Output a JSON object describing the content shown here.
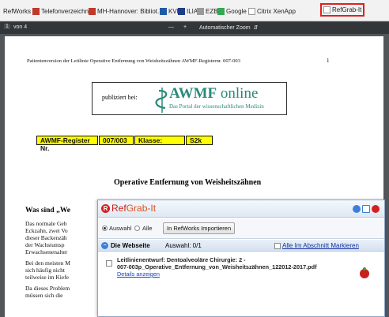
{
  "bookmarks": [
    {
      "label": "RefWorks",
      "icon": "none",
      "color": ""
    },
    {
      "label": "Telefonverzeichnis",
      "icon": "flag-icon",
      "color": "#c0392b"
    },
    {
      "label": "MH-Hannover: Bibliot...",
      "icon": "mhh-icon",
      "color": "#c0392b"
    },
    {
      "label": "KVK",
      "icon": "kvk-icon",
      "color": "#1f5aa6"
    },
    {
      "label": "ILIAS",
      "icon": "ilias-icon",
      "color": "#1f3c88"
    },
    {
      "label": "EZB",
      "icon": "ezb-icon",
      "color": "#888888"
    },
    {
      "label": "Google",
      "icon": "google-icon",
      "color": "#34a853"
    },
    {
      "label": "Citrix XenApp",
      "icon": "page-icon",
      "color": "#cccccc"
    },
    {
      "label": "RefGrab-It",
      "icon": "page-icon",
      "color": "#cccccc"
    }
  ],
  "pdf_toolbar": {
    "page_current": "1",
    "page_total": "von 4",
    "zoom_out": "—",
    "zoom_in": "+",
    "zoom": "Automatischer Zoom"
  },
  "pdf": {
    "header": "Patientenversion der Leitlinie Operative Entfernung von Weisheitszähnen  AWMF-Registernr. 007-003",
    "page_number": "1",
    "publiziert": "publiziert bei:",
    "awmf_brand_bold": "AWMF",
    "awmf_brand_rest": " online",
    "awmf_sub": "Das Portal der wissenschaftlichen Medizin",
    "register": [
      "AWMF-Register Nr.",
      "007/003",
      "Klasse:",
      "S2k"
    ],
    "title": "Operative Entfernung von Weisheitszähnen",
    "section_heading": "Was sind „We",
    "paragraphs": [
      "Das normale Geb",
      "Eckzahn, zwei Vo",
      "dieser Backenzäh",
      "der Wachstumsp",
      "Erwachsenenalter",
      "Bei den meisten M",
      "sich häufig nicht",
      "teilweise im Kiefe",
      "Da dieses Problem",
      "müssen sich die"
    ]
  },
  "refgrab": {
    "title_ref": "Ref",
    "title_grab": "Grab-It",
    "radio_selection": "Auswahl",
    "radio_all": "Alle",
    "import_button": "In RefWorks Importieren",
    "section_title": "Die Webseite",
    "section_count": "Auswahl: 0/1",
    "mark_all": "Alle Im Abschnitt Markieren",
    "item_line1": "Leitlinienentwurf: Dentoalveoläre Chirurgie: 2 -",
    "item_line2": "007-003p_Operative_Entfernung_von_Weisheitszähnen_122012-2017.pdf",
    "details_link": "Details anzeigen"
  }
}
